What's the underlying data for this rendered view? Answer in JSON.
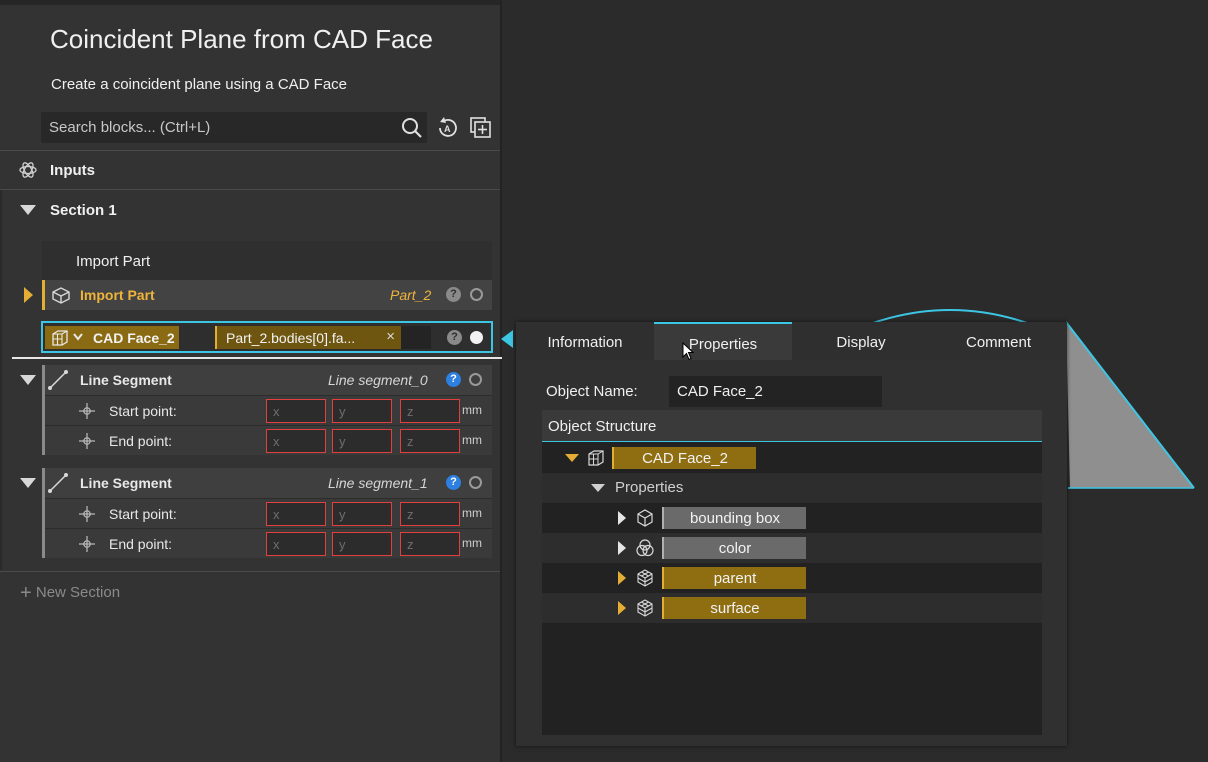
{
  "panel": {
    "title": "Coincident Plane from CAD Face",
    "subtitle": "Create a coincident plane using a CAD Face",
    "search_placeholder": "Search blocks... (Ctrl+L)"
  },
  "inputs": {
    "label": "Inputs"
  },
  "section": {
    "label": "Section 1",
    "import_header": "Import Part",
    "import_row": {
      "label": "Import Part",
      "value": "Part_2"
    },
    "cad_face": {
      "label": "CAD Face_2",
      "value": "Part_2.bodies[0].fa...",
      "clear": "×"
    },
    "line_segments": [
      {
        "label": "Line Segment",
        "value": "Line segment_0",
        "points": [
          {
            "label": "Start point:",
            "x": "x",
            "y": "y",
            "z": "z",
            "unit": "mm"
          },
          {
            "label": "End point:",
            "x": "x",
            "y": "y",
            "z": "z",
            "unit": "mm"
          }
        ]
      },
      {
        "label": "Line Segment",
        "value": "Line segment_1",
        "points": [
          {
            "label": "Start point:",
            "x": "x",
            "y": "y",
            "z": "z",
            "unit": "mm"
          },
          {
            "label": "End point:",
            "x": "x",
            "y": "y",
            "z": "z",
            "unit": "mm"
          }
        ]
      }
    ],
    "help": "?"
  },
  "new_section": "New Section",
  "popup": {
    "tabs": [
      "Information",
      "Properties",
      "Display",
      "Comment"
    ],
    "active_tab": "Properties",
    "object_name_label": "Object Name:",
    "object_name_value": "CAD Face_2",
    "structure_label": "Object Structure",
    "root": "CAD Face_2",
    "properties_label": "Properties",
    "items": [
      "bounding box",
      "color",
      "parent",
      "surface"
    ]
  },
  "colors": {
    "accent": "#3cc6e4",
    "gold": "#e4ae35",
    "gold_fill": "#8f6e12",
    "error_border": "#e0413e",
    "help_blue": "#2d7fe0"
  }
}
